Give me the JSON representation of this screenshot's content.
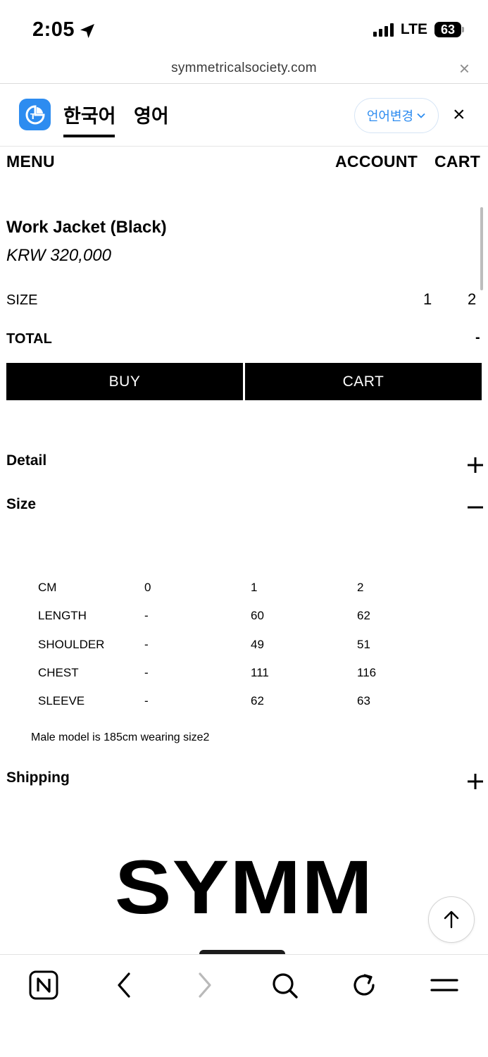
{
  "status_bar": {
    "time": "2:05",
    "network": "LTE",
    "battery": "63"
  },
  "browser": {
    "url": "symmetricalsociety.com",
    "close_glyph": "×"
  },
  "translate_bar": {
    "tab_korean": "한국어",
    "tab_english": "영어",
    "change_language_label": "언어변경",
    "close_glyph": "×",
    "accent_color": "#2d8cf0"
  },
  "site_nav": {
    "menu": "MENU",
    "account": "ACCOUNT",
    "cart": "CART"
  },
  "product": {
    "title": "Work Jacket (Black)",
    "price": "KRW 320,000",
    "size_label": "SIZE",
    "size_options": [
      "1",
      "2"
    ],
    "total_label": "TOTAL",
    "total_value": "-",
    "buy_label": "BUY",
    "cart_label": "CART"
  },
  "accordions": {
    "detail": {
      "title": "Detail",
      "state": "collapsed"
    },
    "size": {
      "title": "Size",
      "state": "expanded"
    },
    "shipping": {
      "title": "Shipping",
      "state": "collapsed"
    }
  },
  "size_table": {
    "header": [
      "CM",
      "0",
      "1",
      "2"
    ],
    "rows": [
      [
        "LENGTH",
        "-",
        "60",
        "62"
      ],
      [
        "SHOULDER",
        "-",
        "49",
        "51"
      ],
      [
        "CHEST",
        "-",
        "111",
        "116"
      ],
      [
        "SLEEVE",
        "-",
        "62",
        "63"
      ]
    ],
    "note": "Male model is 185cm wearing size2"
  },
  "brand_text": "SYMM",
  "icons": {
    "location": "location-arrow-icon",
    "signal": "cellular-signal-icon",
    "battery": "battery-icon",
    "translate_logo": "translate-logo-icon",
    "scroll_top": "arrow-up-icon",
    "toolbar": [
      "naver-home-icon",
      "back-chevron-icon",
      "forward-chevron-icon",
      "search-icon",
      "refresh-icon",
      "menu-icon"
    ]
  }
}
